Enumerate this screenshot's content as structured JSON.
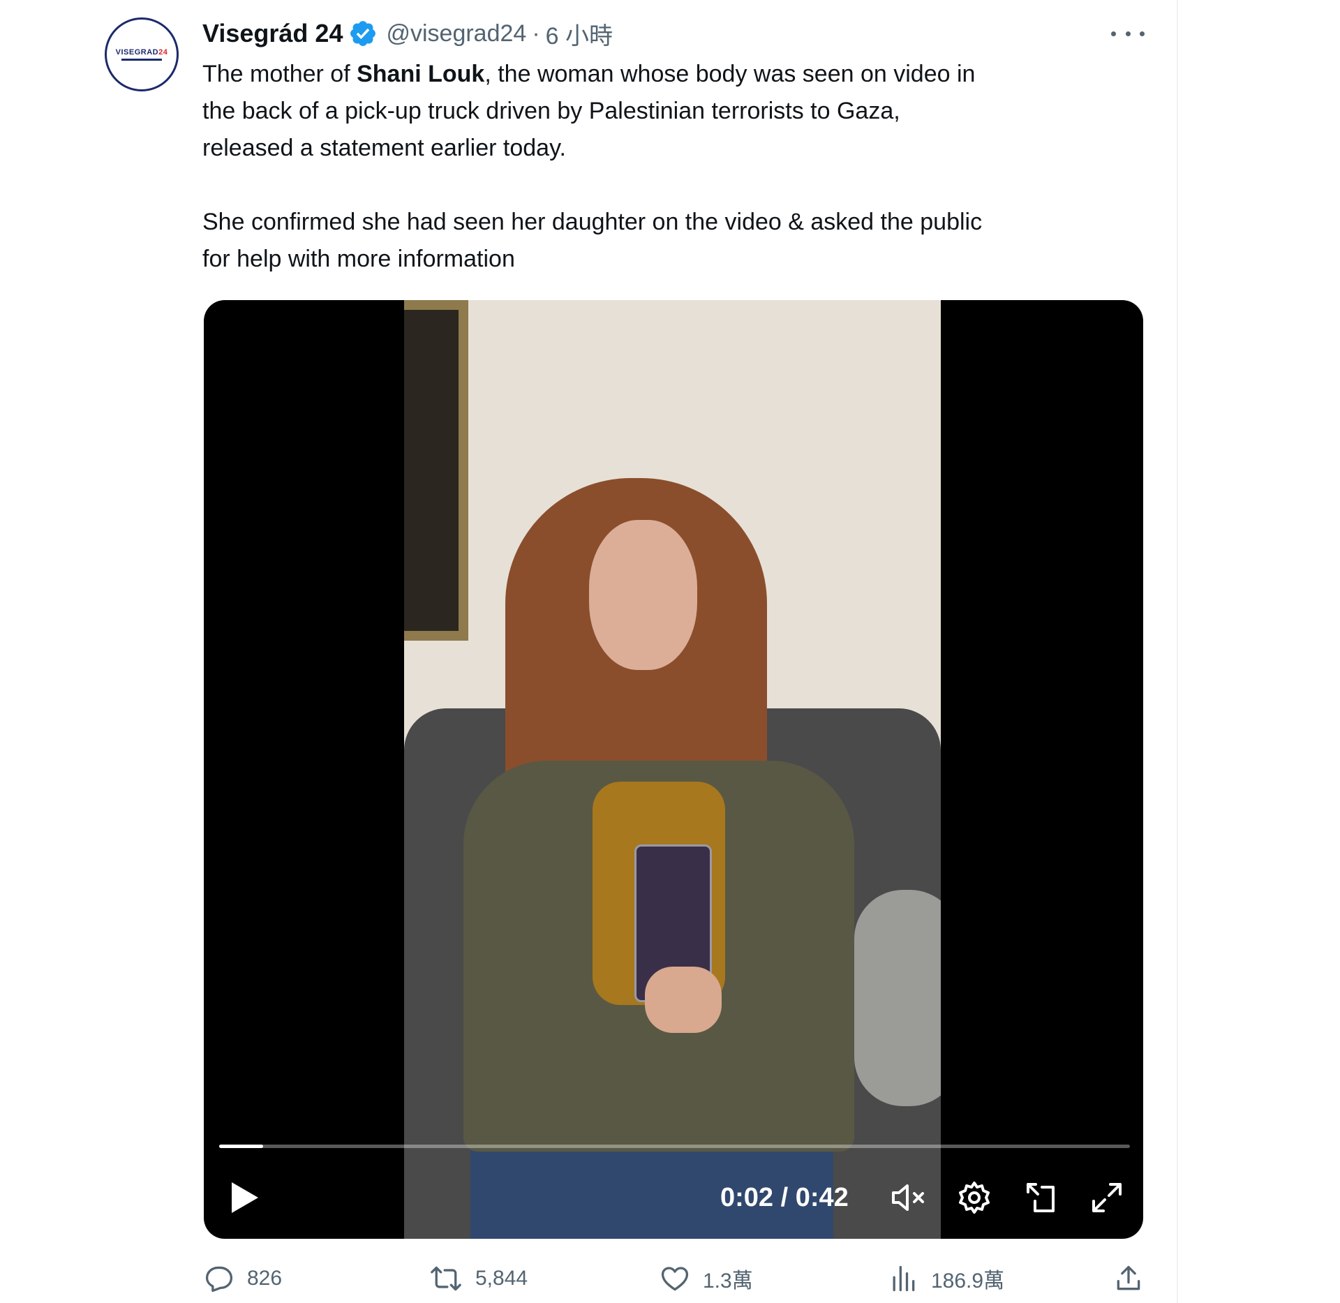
{
  "tweet": {
    "avatar": {
      "logo_text_a": "VISEGRAD",
      "logo_text_b": "24",
      "brand_color": "#1c2a6b",
      "accent_color": "#d9262c"
    },
    "author_name": "Visegrád 24",
    "handle": "@visegrad24",
    "separator": "·",
    "time": "6 小時",
    "verified_color": "#1d9bf0",
    "more_icon": "more-icon",
    "text": {
      "p1_prefix": "The mother of ",
      "p1_bold": "Shani Louk",
      "p1_suffix": ", the woman whose body was seen on video in",
      "p1_line2": "the back of a pick-up truck driven by Palestinian terrorists to Gaza,",
      "p1_line3": "released a statement earlier today.",
      "p2_line1": "She confirmed she had seen her daughter on the video & asked the public",
      "p2_line2": "for help with more information"
    }
  },
  "video": {
    "timecode": "0:02 / 0:42",
    "progress": 0.048,
    "controls": {
      "play": "play-icon",
      "mute": "muted-speaker-icon",
      "settings": "gear-icon",
      "pip": "picture-in-picture-icon",
      "fullscreen": "fullscreen-icon"
    }
  },
  "actions": {
    "replies": "826",
    "reposts": "5,844",
    "likes": "1.3萬",
    "views": "186.9萬",
    "share_icon": "share-icon"
  },
  "colors": {
    "text": "#0f1419",
    "secondary": "#536471",
    "divider": "#eff3f4"
  }
}
